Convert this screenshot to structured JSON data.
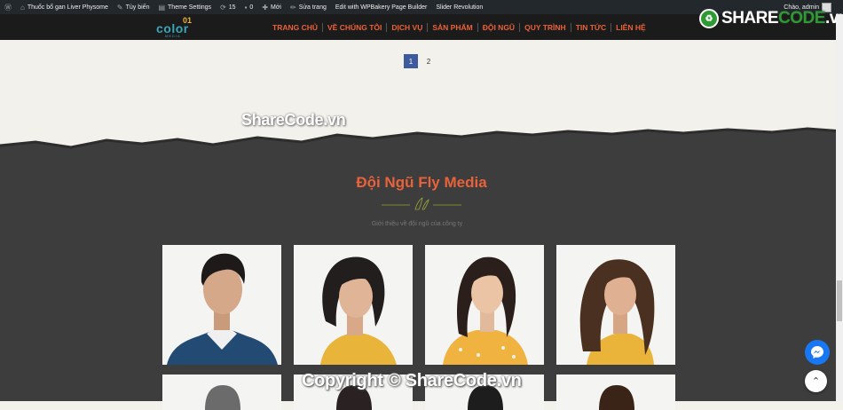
{
  "adminbar": {
    "items": [
      {
        "icon": "wordpress-icon",
        "label": ""
      },
      {
        "icon": "home-icon",
        "label": "Thuốc bổ gan Liver Physome"
      },
      {
        "icon": "brush-icon",
        "label": "Tùy biến"
      },
      {
        "icon": "theme-icon",
        "label": "Theme Settings"
      },
      {
        "icon": "updates-icon",
        "label": "15"
      },
      {
        "icon": "comment-icon",
        "label": "0"
      },
      {
        "icon": "plus-icon",
        "label": "Mới"
      },
      {
        "icon": "pencil-icon",
        "label": "Sửa trang"
      },
      {
        "icon": "",
        "label": "Edit with WPBakery Page Builder"
      },
      {
        "icon": "",
        "label": "Slider Revolution"
      }
    ],
    "greeting": "Chào, admin"
  },
  "logo": {
    "word": "color",
    "num": "01",
    "sub": "MEDIA"
  },
  "menu": [
    "TRANG CHỦ",
    "VỀ CHÚNG TÔI",
    "DỊCH VỤ",
    "SẢN PHẨM",
    "ĐỘI NGŨ",
    "QUY TRÌNH",
    "TIN TỨC",
    "LIÊN HỆ"
  ],
  "sharecode": {
    "prefix": "S",
    "word": "HARE",
    "mid": "CODE",
    "suffix": ".vn"
  },
  "pagination": {
    "pages": [
      "1",
      "2"
    ],
    "current": "1"
  },
  "watermark_top": "ShareCode.vn",
  "team": {
    "title": "Đội Ngũ Fly Media",
    "subtitle": "Giới thiệu về đội ngũ của công ty",
    "accent": "#e8623a"
  },
  "watermark_bottom": "Copyright © ShareCode.vn",
  "colors": {
    "dark_bg": "#3d3d3d",
    "admin_bar": "#23282d",
    "nav_bg": "#1b1b1b",
    "accent": "#e8623a",
    "messenger": "#1877f2"
  }
}
